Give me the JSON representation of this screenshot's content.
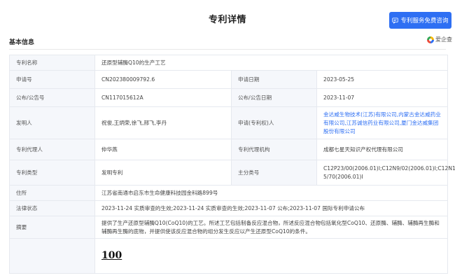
{
  "header": {
    "title": "专利详情",
    "consult_button": "专利服务免费咨询",
    "consult_icon": "chat-icon"
  },
  "section": {
    "title": "基本信息",
    "brand": "爱企查"
  },
  "rows": {
    "name": {
      "label": "专利名称",
      "value": "还原型辅酶Q10的生产工艺"
    },
    "app_no": {
      "label": "申请号",
      "value": "CN202380009792.6",
      "label2": "申请日期",
      "value2": "2023-05-25"
    },
    "pub_no": {
      "label": "公布/公告号",
      "value": "CN117015612A",
      "label2": "公布/公告日期",
      "value2": "2023-11-07"
    },
    "inventor": {
      "label": "发明人",
      "value": "祝俊,王炳荣,徐飞,邢飞,李丹",
      "label2": "申请(专利权)人",
      "value2": [
        "金达威生物技术(江苏)有限公司,",
        "内蒙古金达威药业",
        "有限公司,",
        "江苏诚信药业有限公司,",
        "厦门金达威集团",
        "股份有限公司"
      ]
    },
    "agent": {
      "label": "专利代理人",
      "value": "仲华燕",
      "label2": "专利代理机构",
      "value2": "成都七星天知识产权代理有限公司"
    },
    "type": {
      "label": "专利类型",
      "value": "发明专利",
      "label2": "主分类号",
      "value2": [
        "C12P23/00(2006.01)I;C12N9/02(2006.01)I;C12N1",
        "5/70(2006.01)I"
      ]
    },
    "address": {
      "label": "住所",
      "value": "江苏省南通市启东市生命健康科技园金科路899号"
    },
    "legal": {
      "label": "法律状态",
      "value": "2023-11-24 实质审查的生效;2023-11-24 实质审查的生效;2023-11-07 公布;2023-11-07 国际专利申请公布"
    },
    "abstract": {
      "label": "摘要",
      "value": [
        "提供了生产还原型辅酶Q10(CoQ10)的工艺。所述工艺包括制备反应混合物，所述反应混合物包括氧化型CoQ10、还原酶、辅酶、辅酶再生酶和",
        "辅酶再生酶的底物，并提供使该反应混合物的组分发生反应以产生还原型CoQ10的条件。"
      ]
    },
    "figure": {
      "value": "100"
    }
  }
}
